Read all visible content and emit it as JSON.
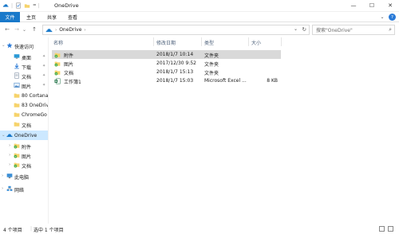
{
  "window": {
    "title": "OneDrive",
    "minimize": "—",
    "maximize": "☐",
    "close": "✕"
  },
  "ribbon": {
    "tabs": [
      "文件",
      "主页",
      "共享",
      "查看"
    ],
    "help": "?",
    "collapse": "⌄"
  },
  "address": {
    "path": [
      "OneDrive"
    ],
    "separator": "›",
    "dropdown": "⌄",
    "refresh": "↻"
  },
  "search": {
    "placeholder": "搜索\"OneDrive\"",
    "icon": "⌕"
  },
  "nav": {
    "back": "←",
    "forward": "→",
    "recent": "⌄",
    "up": "↑"
  },
  "sidebar": {
    "items": [
      {
        "label": "快速访问",
        "icon": "star-icon",
        "level": 0,
        "expand": "⌄"
      },
      {
        "label": "桌面",
        "icon": "desktop-icon",
        "level": 1,
        "pinned": true
      },
      {
        "label": "下载",
        "icon": "download-icon",
        "level": 1,
        "pinned": true
      },
      {
        "label": "文档",
        "icon": "documents-icon",
        "level": 1,
        "pinned": true
      },
      {
        "label": "图片",
        "icon": "pictures-icon",
        "level": 1,
        "pinned": true
      },
      {
        "label": "80 Cortana",
        "icon": "folder-icon",
        "level": 1
      },
      {
        "label": "83 OneDrive",
        "icon": "folder-icon",
        "level": 1
      },
      {
        "label": "ChromeGo",
        "icon": "folder-icon",
        "level": 1
      },
      {
        "label": "文档",
        "icon": "folder-icon",
        "level": 1
      },
      {
        "label": "OneDrive",
        "icon": "onedrive-icon",
        "level": 0,
        "expand": "⌄",
        "selected": true
      },
      {
        "label": "附件",
        "icon": "synced-folder-icon",
        "level": 1,
        "expand": "›"
      },
      {
        "label": "图片",
        "icon": "synced-folder-icon",
        "level": 1,
        "expand": "›"
      },
      {
        "label": "文档",
        "icon": "synced-folder-icon",
        "level": 1,
        "expand": "›"
      },
      {
        "label": "此电脑",
        "icon": "computer-icon",
        "level": 0,
        "expand": "›"
      },
      {
        "label": "网络",
        "icon": "network-icon",
        "level": 0,
        "expand": "›"
      }
    ]
  },
  "columns": [
    "名称",
    "修改日期",
    "类型",
    "大小"
  ],
  "files": [
    {
      "name": "附件",
      "modified": "2018/1/7 10:14",
      "type": "文件夹",
      "size": "",
      "icon": "synced-folder-icon",
      "selected": true
    },
    {
      "name": "图片",
      "modified": "2017/12/30 9:52",
      "type": "文件夹",
      "size": "",
      "icon": "synced-folder-icon"
    },
    {
      "name": "文档",
      "modified": "2018/1/7 15:13",
      "type": "文件夹",
      "size": "",
      "icon": "synced-folder-icon"
    },
    {
      "name": "工作簿1",
      "modified": "2018/1/7 15:03",
      "type": "Microsoft Excel ...",
      "size": "8 KB",
      "icon": "excel-icon"
    }
  ],
  "status": {
    "count": "4 个项目",
    "selected": "选中 1 个项目"
  },
  "colors": {
    "accent": "#1979ca",
    "selected_nav": "#cce8ff",
    "selected_row": "#d9d9d9",
    "folder": "#f6d36b",
    "sync": "#3aa635"
  }
}
